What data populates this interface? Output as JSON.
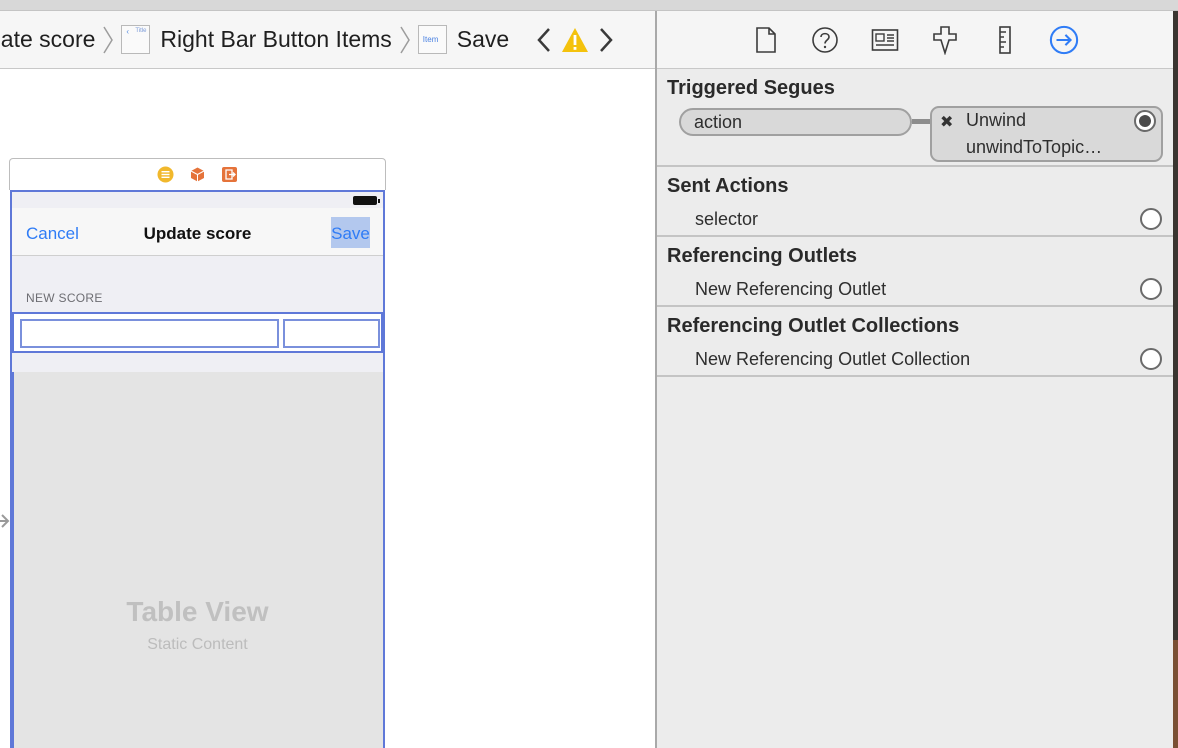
{
  "jumpbar": {
    "crumb_1": "date score",
    "crumb_2": "Right Bar Button Items",
    "crumb_2_thumb": "Title",
    "crumb_3": "Save",
    "crumb_3_thumb": "Item"
  },
  "canvas": {
    "navbar": {
      "cancel_label": "Cancel",
      "title": "Update score",
      "save_label": "Save"
    },
    "section_header": "NEW SCORE",
    "table_view": {
      "title": "Table View",
      "subtitle": "Static Content"
    }
  },
  "inspector": {
    "tabs": [
      "file-inspector-icon",
      "quick-help-icon",
      "identity-inspector-icon",
      "attributes-inspector-icon",
      "size-inspector-icon",
      "connections-inspector-icon"
    ],
    "triggered_segues": {
      "title": "Triggered Segues",
      "source": "action",
      "destination_line_1": "Unwind",
      "destination_line_2": "unwindToTopic…"
    },
    "sent_actions": {
      "title": "Sent Actions",
      "row": "selector"
    },
    "referencing_outlets": {
      "title": "Referencing Outlets",
      "row": "New Referencing Outlet"
    },
    "referencing_outlet_collections": {
      "title": "Referencing Outlet Collections",
      "row": "New Referencing Outlet Collection"
    }
  },
  "colors": {
    "accent_blue": "#2f7cf6",
    "selection_blue": "#5f78d8",
    "warning_yellow": "#f4c20d",
    "dock_yellow": "#f1b82c",
    "dock_orange": "#e5733a"
  }
}
